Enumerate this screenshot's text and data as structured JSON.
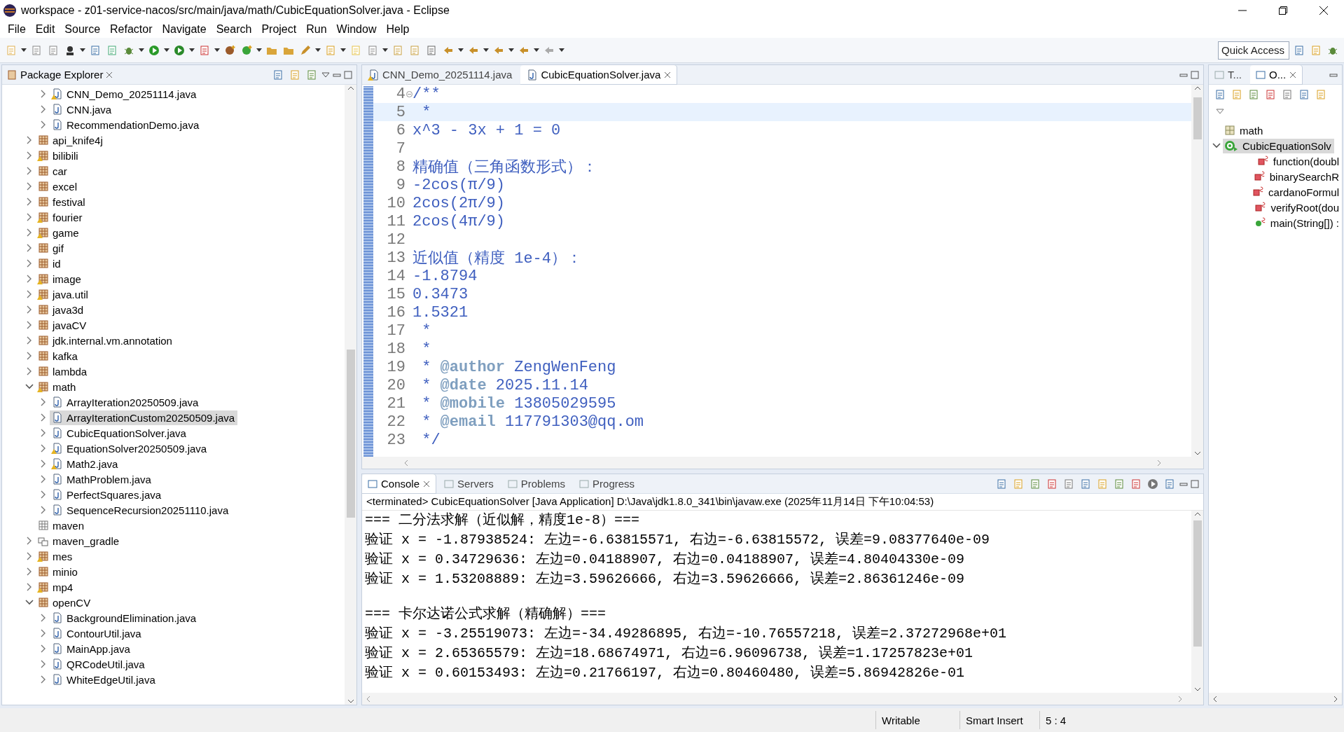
{
  "window": {
    "title": "workspace - z01-service-nacos/src/main/java/math/CubicEquationSolver.java - Eclipse"
  },
  "menu": [
    "File",
    "Edit",
    "Source",
    "Refactor",
    "Navigate",
    "Search",
    "Project",
    "Run",
    "Window",
    "Help"
  ],
  "quick_access": {
    "placeholder": "Quick Access"
  },
  "explorer": {
    "title": "Package Explorer",
    "items": [
      {
        "children": [
          {
            "kind": "file",
            "label": "CNN_Demo_20251114.java",
            "warning": true,
            "expanded": false,
            "selected": false
          },
          {
            "kind": "file",
            "label": "CNN.java",
            "warning": false,
            "expanded": false,
            "selected": false
          },
          {
            "kind": "file",
            "label": "RecommendationDemo.java",
            "warning": false,
            "expanded": false,
            "selected": false
          }
        ]
      },
      {
        "kind": "package",
        "label": "api_knife4j",
        "warning": false,
        "expanded": false,
        "selected": false
      },
      {
        "kind": "package",
        "label": "bilibili",
        "warning": true,
        "expanded": false,
        "selected": false
      },
      {
        "kind": "package",
        "label": "car",
        "warning": false,
        "expanded": false,
        "selected": false
      },
      {
        "kind": "package",
        "label": "excel",
        "warning": false,
        "expanded": false,
        "selected": false
      },
      {
        "kind": "package",
        "label": "festival",
        "warning": false,
        "expanded": false,
        "selected": false
      },
      {
        "kind": "package",
        "label": "fourier",
        "warning": true,
        "expanded": false,
        "selected": false
      },
      {
        "kind": "package",
        "label": "game",
        "warning": true,
        "expanded": false,
        "selected": false
      },
      {
        "kind": "package",
        "label": "gif",
        "warning": false,
        "expanded": false,
        "selected": false
      },
      {
        "kind": "package",
        "label": "id",
        "warning": false,
        "expanded": false,
        "selected": false
      },
      {
        "kind": "package",
        "label": "image",
        "warning": true,
        "expanded": false,
        "selected": false
      },
      {
        "kind": "package",
        "label": "java.util",
        "warning": true,
        "expanded": false,
        "selected": false
      },
      {
        "kind": "package",
        "label": "java3d",
        "warning": false,
        "expanded": false,
        "selected": false
      },
      {
        "kind": "package",
        "label": "javaCV",
        "warning": false,
        "expanded": false,
        "selected": false
      },
      {
        "kind": "package",
        "label": "jdk.internal.vm.annotation",
        "warning": false,
        "expanded": false,
        "selected": false
      },
      {
        "kind": "package",
        "label": "kafka",
        "warning": false,
        "expanded": false,
        "selected": false
      },
      {
        "kind": "package",
        "label": "lambda",
        "warning": false,
        "expanded": false,
        "selected": false
      },
      {
        "kind": "package",
        "label": "math",
        "warning": true,
        "expanded": true,
        "selected": false,
        "children": [
          {
            "kind": "file",
            "label": "ArrayIteration20250509.java",
            "warning": false,
            "expanded": false,
            "selected": false
          },
          {
            "kind": "file",
            "label": "ArrayIterationCustom20250509.java",
            "warning": false,
            "expanded": false,
            "selected": true
          },
          {
            "kind": "file",
            "label": "CubicEquationSolver.java",
            "warning": false,
            "expanded": false,
            "selected": false
          },
          {
            "kind": "file",
            "label": "EquationSolver20250509.java",
            "warning": true,
            "expanded": false,
            "selected": false
          },
          {
            "kind": "file",
            "label": "Math2.java",
            "warning": true,
            "expanded": false,
            "selected": false
          },
          {
            "kind": "file",
            "label": "MathProblem.java",
            "warning": false,
            "expanded": false,
            "selected": false
          },
          {
            "kind": "file",
            "label": "PerfectSquares.java",
            "warning": false,
            "expanded": false,
            "selected": false
          },
          {
            "kind": "file",
            "label": "SequenceRecursion20251110.java",
            "warning": false,
            "expanded": false,
            "selected": false
          }
        ]
      },
      {
        "kind": "empty-package",
        "label": "maven",
        "selected": false
      },
      {
        "kind": "folder",
        "label": "maven_gradle",
        "expanded": false,
        "selected": false
      },
      {
        "kind": "package",
        "label": "mes",
        "warning": true,
        "expanded": false,
        "selected": false
      },
      {
        "kind": "package",
        "label": "minio",
        "warning": false,
        "expanded": false,
        "selected": false
      },
      {
        "kind": "package",
        "label": "mp4",
        "warning": true,
        "expanded": false,
        "selected": false
      },
      {
        "kind": "package",
        "label": "openCV",
        "warning": false,
        "expanded": true,
        "selected": false,
        "children": [
          {
            "kind": "file",
            "label": "BackgroundElimination.java",
            "warning": false,
            "expanded": false,
            "selected": false
          },
          {
            "kind": "file",
            "label": "ContourUtil.java",
            "warning": false,
            "expanded": false,
            "selected": false
          },
          {
            "kind": "file",
            "label": "MainApp.java",
            "warning": false,
            "expanded": false,
            "selected": false
          },
          {
            "kind": "file",
            "label": "QRCodeUtil.java",
            "warning": false,
            "expanded": false,
            "selected": false
          },
          {
            "kind": "file",
            "label": "WhiteEdgeUtil.java",
            "warning": false,
            "expanded": false,
            "selected": false
          }
        ]
      }
    ]
  },
  "editor": {
    "tabs": [
      {
        "label": "CNN_Demo_20251114.java",
        "warning": true,
        "selected": false
      },
      {
        "label": "CubicEquationSolver.java",
        "warning": false,
        "selected": true
      }
    ],
    "lines": [
      {
        "number": "4",
        "text": "/**",
        "folded": false,
        "current": false
      },
      {
        "number": "5",
        "text": " *",
        "current": true
      },
      {
        "number": "6",
        "text": "x^3 - 3x + 1 = 0",
        "current": false
      },
      {
        "number": "7",
        "current": false
      },
      {
        "number": "8",
        "text": "精确值（三角函数形式）：",
        "current": false
      },
      {
        "number": "9",
        "text": "-2cos(π/9)",
        "current": false
      },
      {
        "number": "10",
        "text": "2cos(2π/9)",
        "current": false
      },
      {
        "number": "11",
        "text": "2cos(4π/9)",
        "current": false
      },
      {
        "number": "12",
        "current": false
      },
      {
        "number": "13",
        "text": "近似值（精度 1e-4）：",
        "current": false
      },
      {
        "number": "14",
        "text": "-1.8794",
        "current": false
      },
      {
        "number": "15",
        "text": "0.3473",
        "current": false
      },
      {
        "number": "16",
        "text": "1.5321",
        "current": false
      },
      {
        "number": "17",
        "text": " *",
        "current": false
      },
      {
        "number": "18",
        "text": " *",
        "current": false
      },
      {
        "number": "19",
        "text": " * **@author** ZengWenFeng",
        "current": false
      },
      {
        "number": "20",
        "text": " * **@date** 2025.11.14",
        "current": false
      },
      {
        "number": "21",
        "text": " * **@mobile** 13805029595",
        "current": false
      },
      {
        "number": "22",
        "text": " * **@email** 117791303@qq.om",
        "current": false
      },
      {
        "number": "23",
        "text": " */",
        "current": false
      }
    ]
  },
  "console": {
    "tabs": [
      {
        "label": "Console",
        "selected": true
      },
      {
        "label": "Servers",
        "selected": false
      },
      {
        "label": "Problems",
        "selected": false
      },
      {
        "label": "Progress",
        "selected": false
      }
    ],
    "header": "<terminated> CubicEquationSolver [Java Application] D:\\Java\\jdk1.8.0_341\\bin\\javaw.exe (2025年11月14日 下午10:04:53)",
    "groups": [
      {
        "lines": [
          "=== 二分法求解（近似解，精度1e-8）===",
          "验证 x = -1.87938524: 左边=-6.63815571, 右边=-6.63815572, 误差=9.08377640e-09",
          "验证 x = 0.34729636: 左边=0.04188907, 右边=0.04188907, 误差=4.80404330e-09",
          "验证 x = 1.53208889: 左边=3.59626666, 右边=3.59626666, 误差=2.86361246e-09"
        ]
      },
      {
        "lines": [
          "=== 卡尔达诺公式求解（精确解）===",
          "验证 x = -3.25519073: 左边=-34.49286895, 右边=-10.76557218, 误差=2.37272968e+01",
          "验证 x = 2.65365579: 左边=18.68674971, 右边=6.96096738, 误差=1.17257823e+01",
          "验证 x = 0.60153493: 左边=0.21766197, 右边=0.80460480, 误差=5.86942826e-01"
        ]
      }
    ]
  },
  "outline": {
    "tabs": [
      {
        "label": "T...",
        "selected": false
      },
      {
        "label": "O...",
        "selected": true
      }
    ],
    "items": [
      {
        "kind": "package",
        "label": "math",
        "selected": false
      },
      {
        "kind": "class",
        "label": "CubicEquationSolv",
        "selected": true,
        "expanded": true,
        "children": [
          {
            "kind": "private-method",
            "label": "function(doubl",
            "selected": false
          },
          {
            "kind": "private-method",
            "label": "binarySearchR",
            "selected": false
          },
          {
            "kind": "private-method",
            "label": "cardanoFormul",
            "selected": false
          },
          {
            "kind": "private-method",
            "label": "verifyRoot(dou",
            "selected": false
          },
          {
            "kind": "public-method",
            "label": "main(String[]) :",
            "selected": false
          }
        ]
      }
    ]
  },
  "status_bar": {
    "mode": "Writable",
    "insert": "Smart Insert",
    "position": "5 : 4"
  }
}
